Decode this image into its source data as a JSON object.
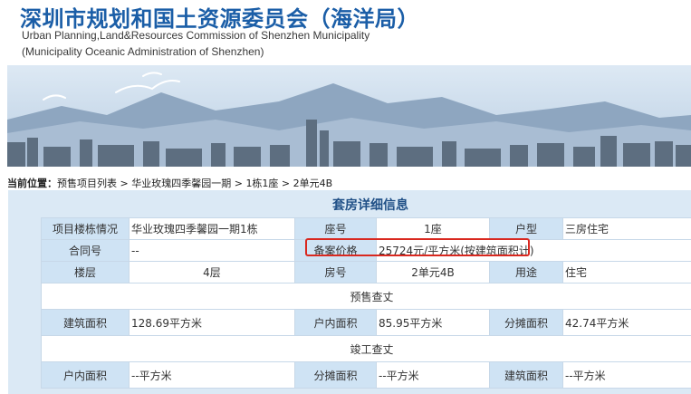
{
  "header": {
    "title_cn": "深圳市规划和国土资源委员会（海洋局）",
    "title_en_line1": "Urban Planning,Land&Resources Commission of Shenzhen Municipality",
    "title_en_line2": "(Municipality Oceanic Administration of Shenzhen)"
  },
  "breadcrumb": {
    "lead": "当前位置：",
    "items": [
      "预售项目列表",
      "华业玫瑰四季馨园一期",
      "1栋1座",
      "2单元4B"
    ],
    "separator": " > "
  },
  "panel": {
    "title": "套房详细信息"
  },
  "table": {
    "row1": {
      "building_label": "项目楼栋情况",
      "building_value": "华业玫瑰四季馨园一期1栋",
      "seat_label": "座号",
      "seat_value": "1座",
      "type_label": "户型",
      "type_value": "三房住宅"
    },
    "row2": {
      "contract_label": "合同号",
      "contract_value": "--",
      "price_label": "备案价格",
      "price_value": "25724元/平方米(按建筑面积计)"
    },
    "row3": {
      "floor_label": "楼层",
      "floor_value": "4层",
      "room_label": "房号",
      "room_value": "2单元4B",
      "use_label": "用途",
      "use_value": "住宅"
    },
    "presale_section": "预售查丈",
    "row5": {
      "build_area_label": "建筑面积",
      "build_area_value": "128.69平方米",
      "inner_area_label": "户内面积",
      "inner_area_value": "85.95平方米",
      "shared_area_label": "分摊面积",
      "shared_area_value": "42.74平方米"
    },
    "completion_section": "竣工查丈",
    "row7": {
      "inner_area_label": "户内面积",
      "inner_area_value": "--平方米",
      "shared_area_label": "分摊面积",
      "shared_area_value": "--平方米",
      "build_area_label": "建筑面积",
      "build_area_value": "--平方米"
    }
  },
  "colors": {
    "title_blue": "#1b5ea7",
    "panel_bg": "#dbe9f5",
    "label_cell_bg": "#cfe3f4",
    "highlight_red": "#d9281f"
  }
}
